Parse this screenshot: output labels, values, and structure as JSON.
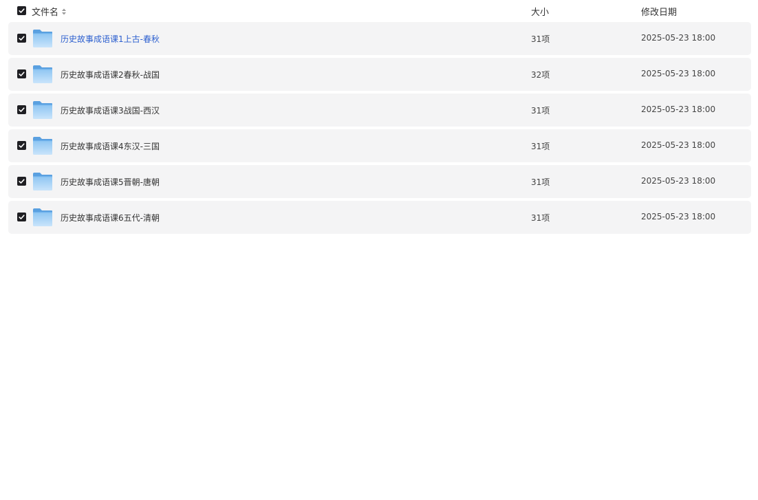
{
  "header": {
    "name_label": "文件名",
    "size_label": "大小",
    "date_label": "修改日期",
    "select_all_checked": true
  },
  "accent_color": "#2c5fcf",
  "files": [
    {
      "name": "历史故事成语课1上古-春秋",
      "size": "31项",
      "date": "2025-05-23 18:00",
      "checked": true,
      "icon": "folder-icon"
    },
    {
      "name": "历史故事成语课2春秋-战国",
      "size": "32项",
      "date": "2025-05-23 18:00",
      "checked": true,
      "icon": "folder-icon"
    },
    {
      "name": "历史故事成语课3战国-西汉",
      "size": "31项",
      "date": "2025-05-23 18:00",
      "checked": true,
      "icon": "folder-icon"
    },
    {
      "name": "历史故事成语课4东汉-三国",
      "size": "31项",
      "date": "2025-05-23 18:00",
      "checked": true,
      "icon": "folder-icon"
    },
    {
      "name": "历史故事成语课5晋朝-唐朝",
      "size": "31项",
      "date": "2025-05-23 18:00",
      "checked": true,
      "icon": "folder-icon"
    },
    {
      "name": "历史故事成语课6五代-清朝",
      "size": "31项",
      "date": "2025-05-23 18:00",
      "checked": true,
      "icon": "folder-icon"
    }
  ]
}
